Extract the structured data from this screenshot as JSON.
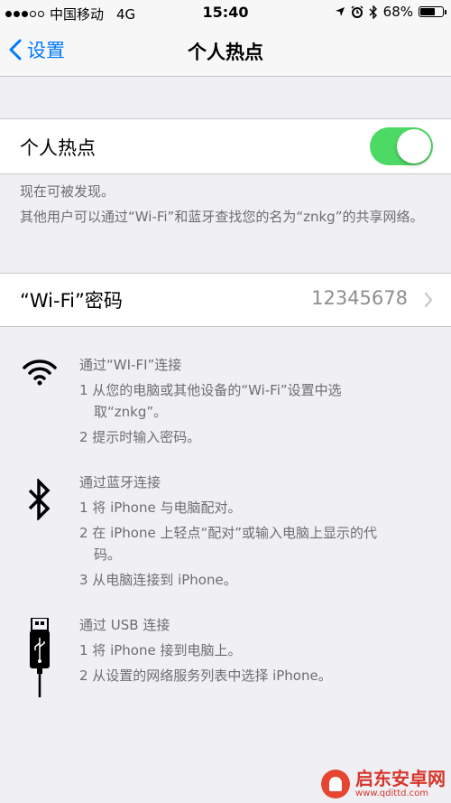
{
  "status": {
    "carrier": "中国移动",
    "network": "4G",
    "time": "15:40",
    "battery": "68%",
    "battery_level": 0.68
  },
  "nav": {
    "back_label": "设置",
    "title": "个人热点"
  },
  "hotspot": {
    "label": "个人热点",
    "enabled": true
  },
  "discoverable_text": "现在可被发现。",
  "info_text": "其他用户可以通过“Wi-Fi”和蓝牙查找您的名为“znkg”的共享网络。",
  "wifi_password": {
    "label": "“Wi-Fi”密码",
    "value": "12345678"
  },
  "sections": {
    "wifi": {
      "title": "通过“WI-FI”连接",
      "step1": "1 从您的电脑或其他设备的“Wi-Fi”设置中选",
      "step1b": "取“znkg”。",
      "step2": "2 提示时输入密码。"
    },
    "bluetooth": {
      "title": "通过蓝牙连接",
      "step1": "1 将 iPhone 与电脑配对。",
      "step2": "2 在 iPhone 上轻点“配对”或输入电脑上显示的代",
      "step2b": "码。",
      "step3": "3 从电脑连接到 iPhone。"
    },
    "usb": {
      "title": "通过 USB 连接",
      "step1": "1 将 iPhone 接到电脑上。",
      "step2": "2 从设置的网络服务列表中选择 iPhone。"
    }
  },
  "watermark": {
    "name": "启东安卓网",
    "url": "www.qdittd.com"
  },
  "colors": {
    "accent": "#007aff",
    "toggle_on": "#4cd964",
    "secondary_text": "#6d6d72"
  }
}
